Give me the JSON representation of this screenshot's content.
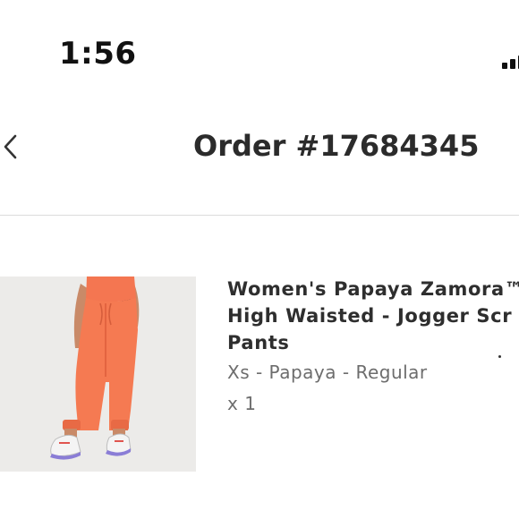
{
  "status_bar": {
    "time": "1:56"
  },
  "header": {
    "back_icon": "chevron-left-icon",
    "title": "Order #17684345"
  },
  "order_item": {
    "image_icon": "product-photo-jogger-pants",
    "name_lines": [
      "Women's Papaya Zamora™",
      "High Waisted - Jogger Scr",
      "Pants"
    ],
    "variant": "Xs - Papaya - Regular",
    "quantity": "x 1"
  },
  "colors": {
    "text_primary": "#2b2b2b",
    "text_secondary": "#6d6d6d",
    "divider": "#dcdcdc",
    "product_color": "#f57a52"
  }
}
